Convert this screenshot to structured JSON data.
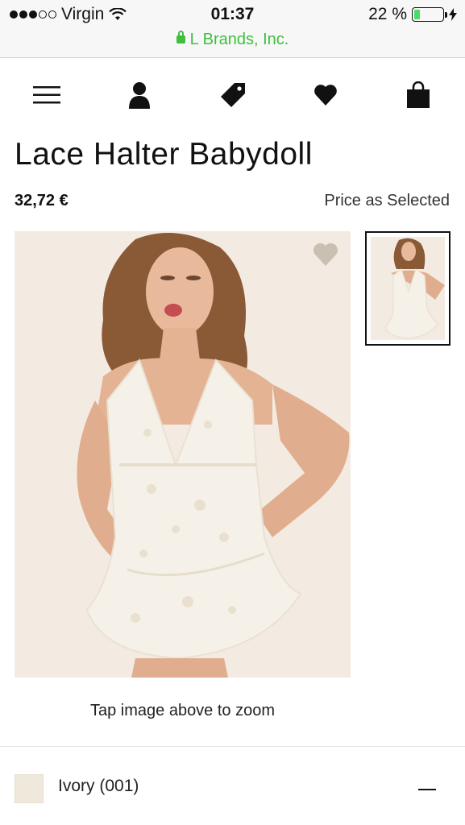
{
  "status_bar": {
    "carrier": "Virgin",
    "time": "01:37",
    "battery_percent_label": "22 %",
    "battery_level": 0.22,
    "url": "L Brands, Inc."
  },
  "nav": {
    "icons": [
      "menu-icon",
      "account-icon",
      "tag-icon",
      "heart-icon",
      "shopping-bag-icon"
    ]
  },
  "product": {
    "title": "Lace Halter Babydoll",
    "price": "32,72 €",
    "price_note": "Price as Selected",
    "zoom_hint": "Tap image above to zoom",
    "color_option": "Ivory (001)"
  },
  "colors": {
    "accent_green": "#3fbf3f",
    "image_bg": "#f3ebe2",
    "swatch": "#efe9dc"
  }
}
